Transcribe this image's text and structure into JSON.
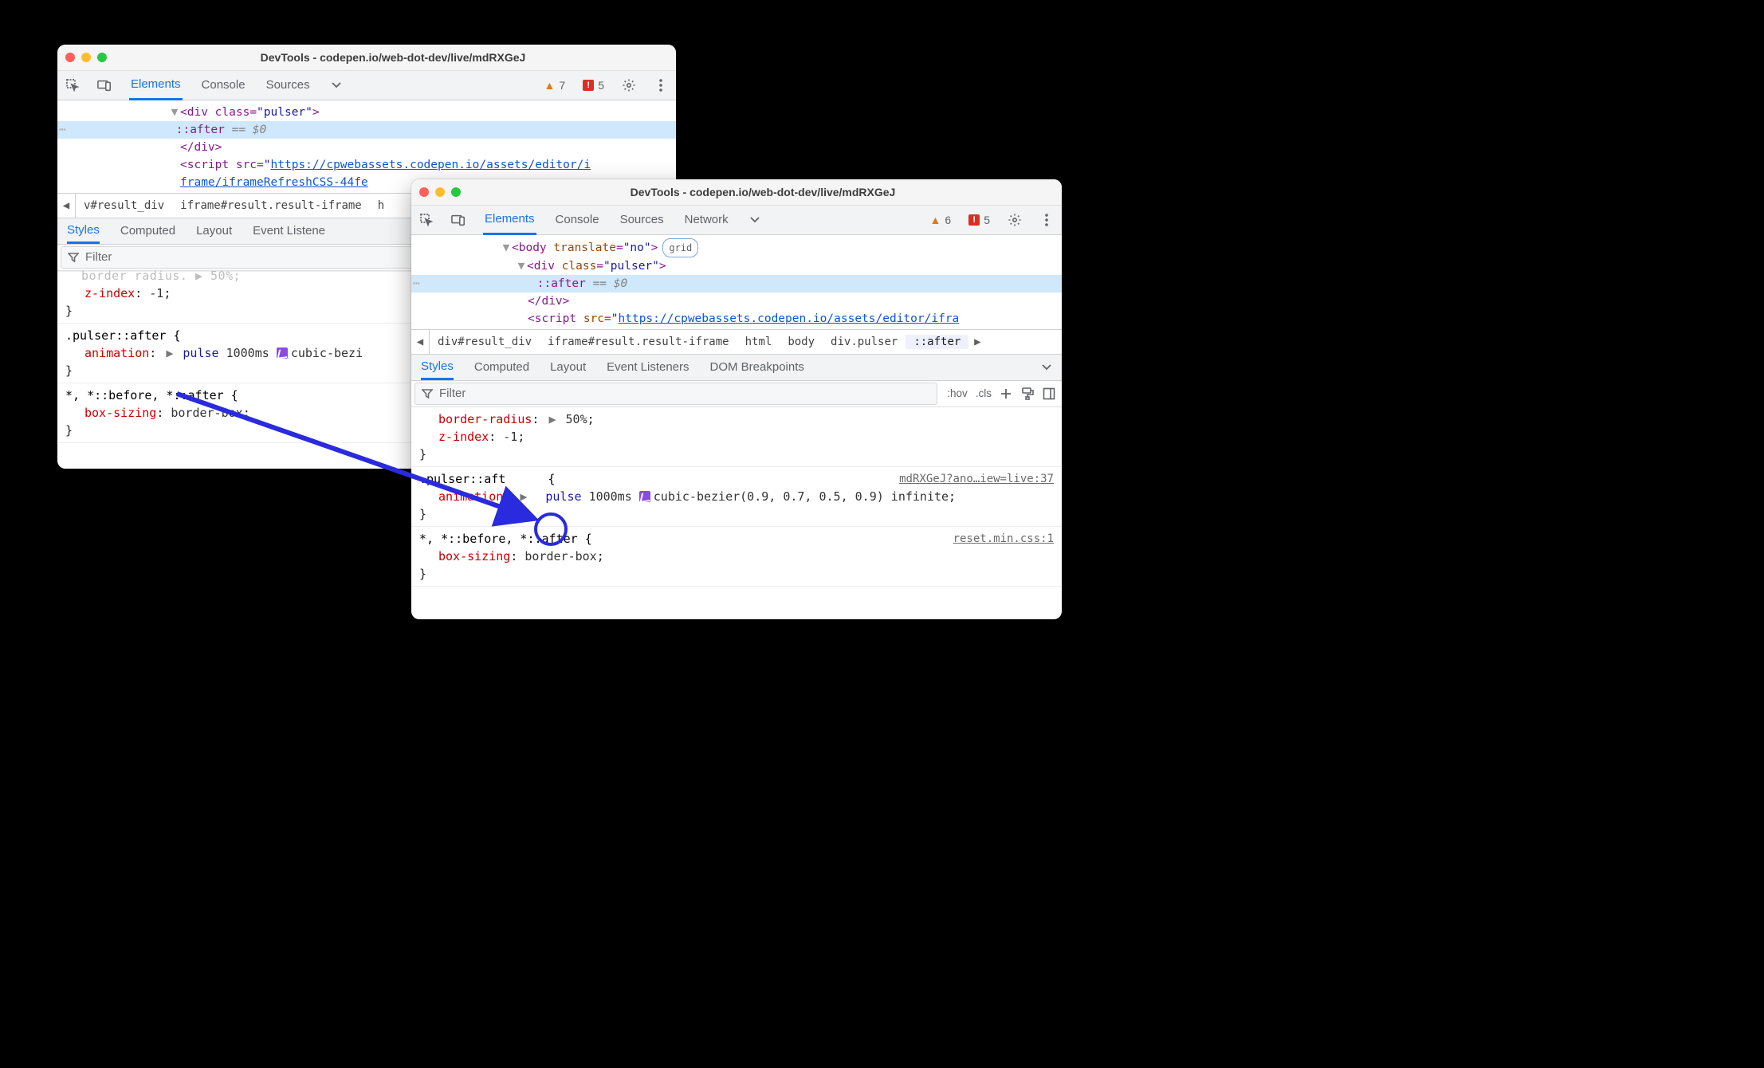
{
  "winBack": {
    "title": "DevTools - codepen.io/web-dot-dev/live/mdRXGeJ",
    "tabs": {
      "elements": "Elements",
      "console": "Console",
      "sources": "Sources"
    },
    "warnCount": "7",
    "errCount": "5",
    "dom": {
      "divOpen_pre": "<div class",
      "divOpen_eq": "=",
      "divOpen_val": "\"pulser\"",
      "divOpen_post": ">",
      "after": "::after",
      "afterSuffix": " == $0",
      "divClose": "</div>",
      "script_pre": "<script src",
      "script_eq": "=",
      "script_q": "\"",
      "script_url": "https://cpwebassets.codepen.io/assets/editor/i",
      "script_url2": "frame/iframeRefreshCSS-44fe"
    },
    "crumb": {
      "a": "v#result_div",
      "b": "iframe#result.result-iframe",
      "c": "h"
    },
    "ptabs": {
      "styles": "Styles",
      "computed": "Computed",
      "layout": "Layout",
      "ev": "Event Listene"
    },
    "filter": "Filter",
    "css": {
      "frag_prop": "border-radius",
      "frag_arrow": "▶",
      "frag_val": "50%;",
      "zprop": "z-index",
      "zval": "-1",
      "sel2": ".pulser::after {",
      "anim_prop": "animation",
      "anim_expand": "▶",
      "anim_name": "pulse",
      "anim_dur": "1000ms",
      "anim_timing": "cubic-bezi",
      "close": "}",
      "sel3": "*, *::before, *::after {",
      "box_prop": "box-sizing",
      "box_val": "border-box"
    }
  },
  "winFront": {
    "title": "DevTools - codepen.io/web-dot-dev/live/mdRXGeJ",
    "tabs": {
      "elements": "Elements",
      "console": "Console",
      "sources": "Sources",
      "network": "Network"
    },
    "warnCount": "6",
    "errCount": "5",
    "dom": {
      "body_pre": "<body ",
      "body_attr": "translate",
      "body_eq": "=",
      "body_val": "\"no\"",
      "body_post": ">",
      "pill": "grid",
      "div_pre": "<div ",
      "div_attr": "class",
      "div_eq": "=",
      "div_val": "\"pulser\"",
      "div_post": ">",
      "after": "::after",
      "afterSuffix": " == $0",
      "divClose": "</div>",
      "script_pre": "<script ",
      "script_attr": "src",
      "script_eq": "=",
      "script_q": "\"",
      "script_url": "https://cpwebassets.codepen.io/assets/editor/ifra"
    },
    "crumb": {
      "a": "div#result_div",
      "b": "iframe#result.result-iframe",
      "c": "html",
      "d": "body",
      "e": "div.pulser",
      "f": "::after"
    },
    "ptabs": {
      "styles": "Styles",
      "computed": "Computed",
      "layout": "Layout",
      "ev": "Event Listeners",
      "dom": "DOM Breakpoints"
    },
    "filter": "Filter",
    "toks": {
      "hov": ":hov",
      "cls": ".cls"
    },
    "css": {
      "br_prop": "border-radius",
      "br_arrow": "▶",
      "br_val": "50%",
      "z_prop": "z-index",
      "z_val": "-1",
      "sel2": ".pulser::after {",
      "sel2b": ".pulser::aft",
      "sel2c": " {",
      "src2": "mdRXGeJ?ano…iew=live:37",
      "anim_prop": "animation",
      "anim_expand": "▶",
      "anim_name": "pulse",
      "anim_dur": "1000ms",
      "anim_timing": "cubic-bezier(0.9, 0.7, 0.5, 0.9)",
      "anim_inf": "infinite",
      "sel3": "*, *::before, *::after {",
      "src3": "reset.min.css:1",
      "box_prop": "box-sizing",
      "box_val": "border-box",
      "close": "}"
    }
  }
}
